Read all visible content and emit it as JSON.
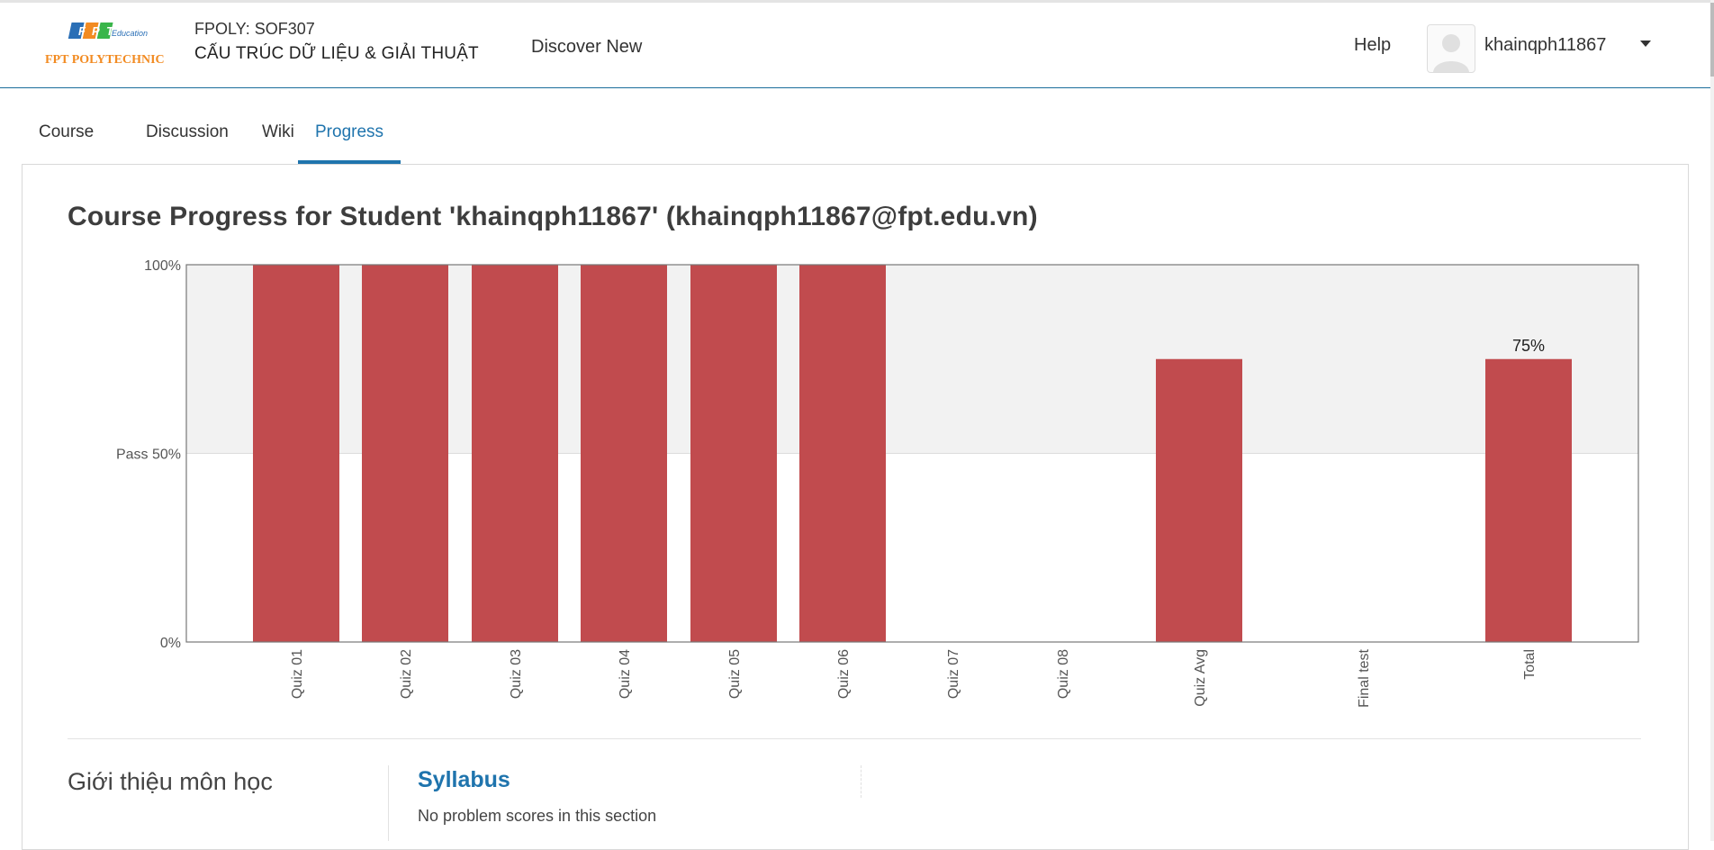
{
  "header": {
    "logo_brand": "FPT",
    "logo_sub": "Education",
    "logo_school": "FPT POLYTECHNIC",
    "course_org": "FPOLY: SOF307",
    "course_title": "CẤU TRÚC DỮ LIỆU & GIẢI THUẬT",
    "discover": "Discover New",
    "help": "Help",
    "username": "khainqph11867"
  },
  "tabs": [
    {
      "label": "Course",
      "active": false
    },
    {
      "label": "Discussion",
      "active": false
    },
    {
      "label": "Wiki",
      "active": false
    },
    {
      "label": "Progress",
      "active": true
    }
  ],
  "page": {
    "title": "Course Progress for Student 'khainqph11867' (khainqph11867@fpt.edu.vn)"
  },
  "colors": {
    "bar": "#c14b4e",
    "pass_zone": "#f2f2f2",
    "accent": "#1f74ad"
  },
  "chart_data": {
    "type": "bar",
    "categories": [
      "Quiz 01",
      "Quiz 02",
      "Quiz 03",
      "Quiz 04",
      "Quiz 05",
      "Quiz 06",
      "Quiz 07",
      "Quiz 08",
      "Quiz Avg",
      "Final test",
      "Total"
    ],
    "values": [
      100,
      100,
      100,
      100,
      100,
      100,
      0,
      0,
      75,
      0,
      75
    ],
    "y_ticks": [
      {
        "value": 100,
        "label": "100%"
      },
      {
        "value": 50,
        "label": "Pass 50%"
      },
      {
        "value": 0,
        "label": "0%"
      }
    ],
    "ylim": [
      0,
      100
    ],
    "pass_threshold": 50,
    "data_labels": [
      {
        "category": "Total",
        "label": "75%"
      }
    ]
  },
  "section": {
    "title": "Giới thiệu môn học",
    "subsection": "Syllabus",
    "status": "No problem scores in this section"
  }
}
